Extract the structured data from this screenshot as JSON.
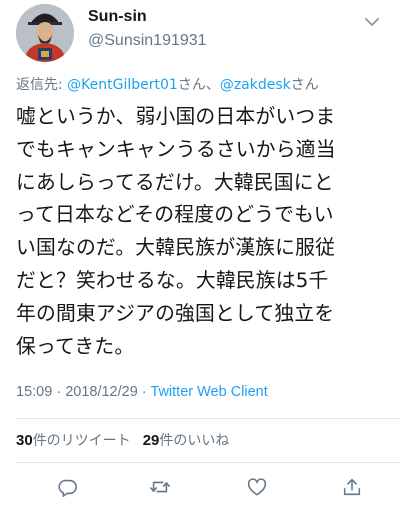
{
  "user": {
    "display_name": "Sun-sin",
    "handle": "@Sunsin191931"
  },
  "reply": {
    "prefix": "返信先: ",
    "mention1": "@KentGilbert01",
    "suffix1": "さん、",
    "mention2": "@zakdesk",
    "suffix2": "さん"
  },
  "tweet": {
    "lines": [
      "嘘というか、弱小国の日本がいつま",
      "でもキャンキャンうるさいから適当",
      "にあしらってるだけ。大韓民国にと",
      "って日本などその程度のどうでもい",
      "い国なのだ。大韓民族が漢族に服従",
      "だと？笑わせるな。大韓民族は5千",
      "年の間東アジアの強国として独立を",
      "保ってきた。"
    ]
  },
  "meta": {
    "time": "15:09",
    "sep1": " · ",
    "date": "2018/12/29",
    "sep2": " · ",
    "client": "Twitter Web Client"
  },
  "stats": {
    "retweet_count": "30",
    "retweet_label": "件のリツイート",
    "like_count": "29",
    "like_label": "件のいいね"
  },
  "icons": {
    "follow": "follow-chevron-icon",
    "reply": "reply-icon",
    "retweet": "retweet-icon",
    "like": "like-icon",
    "share": "share-icon"
  },
  "colors": {
    "text": "#14171a",
    "secondary": "#657786",
    "link": "#1da1f2",
    "divider": "#e1e8ed"
  }
}
